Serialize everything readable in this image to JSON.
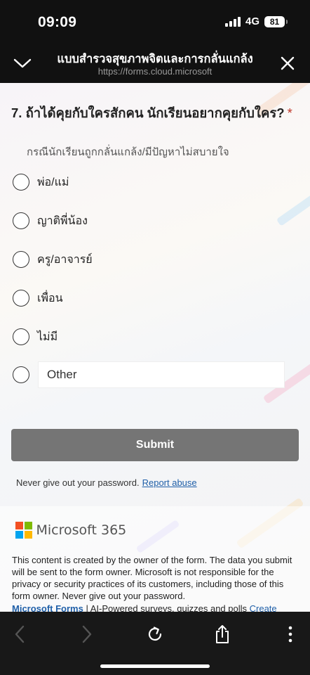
{
  "status_bar": {
    "time": "09:09",
    "network": "4G",
    "battery": "81"
  },
  "header": {
    "title": "แบบสำรวจสุขภาพจิตและการกลั่นแกล้ง",
    "url": "https://forms.cloud.microsoft",
    "collapse_icon": "chevron-down-icon",
    "close_icon": "close-icon"
  },
  "question": {
    "number_title": "7. ถ้าได้คุยกับใครสักคน นักเรียนอยากคุยกับใคร?",
    "required_mark": "*",
    "subtitle": "กรณีนักเรียนถูกกลั่นแกล้ง/มีปัญหาไม่สบายใจ",
    "options": [
      {
        "label": "พ่อ/แม่"
      },
      {
        "label": "ญาติพี่น้อง"
      },
      {
        "label": "ครู/อาจารย์"
      },
      {
        "label": "เพื่อน"
      },
      {
        "label": "ไม่มี"
      }
    ],
    "other_placeholder": "Other"
  },
  "submit_label": "Submit",
  "warning": {
    "text": "Never give out your password.",
    "link": "Report abuse"
  },
  "footer": {
    "brand": "Microsoft 365",
    "disclaimer": "This content is created by the owner of the form. The data you submit will be sent to the form owner. Microsoft is not responsible for the privacy or security practices of its customers, including those of this form owner. Never give out your password.",
    "forms_brand": "Microsoft Forms",
    "forms_tagline": " | AI-Powered surveys, quizzes and polls ",
    "create_link": "Create"
  },
  "colors": {
    "accent_link": "#1f5fa8",
    "submit_bg": "#757575",
    "required": "#c0392b",
    "ms_red": "#f25022",
    "ms_green": "#7fba00",
    "ms_blue": "#00a4ef",
    "ms_yellow": "#ffb900"
  },
  "toolbar": {
    "icons": [
      "back-icon",
      "forward-icon",
      "reload-icon",
      "share-icon",
      "more-icon"
    ]
  }
}
